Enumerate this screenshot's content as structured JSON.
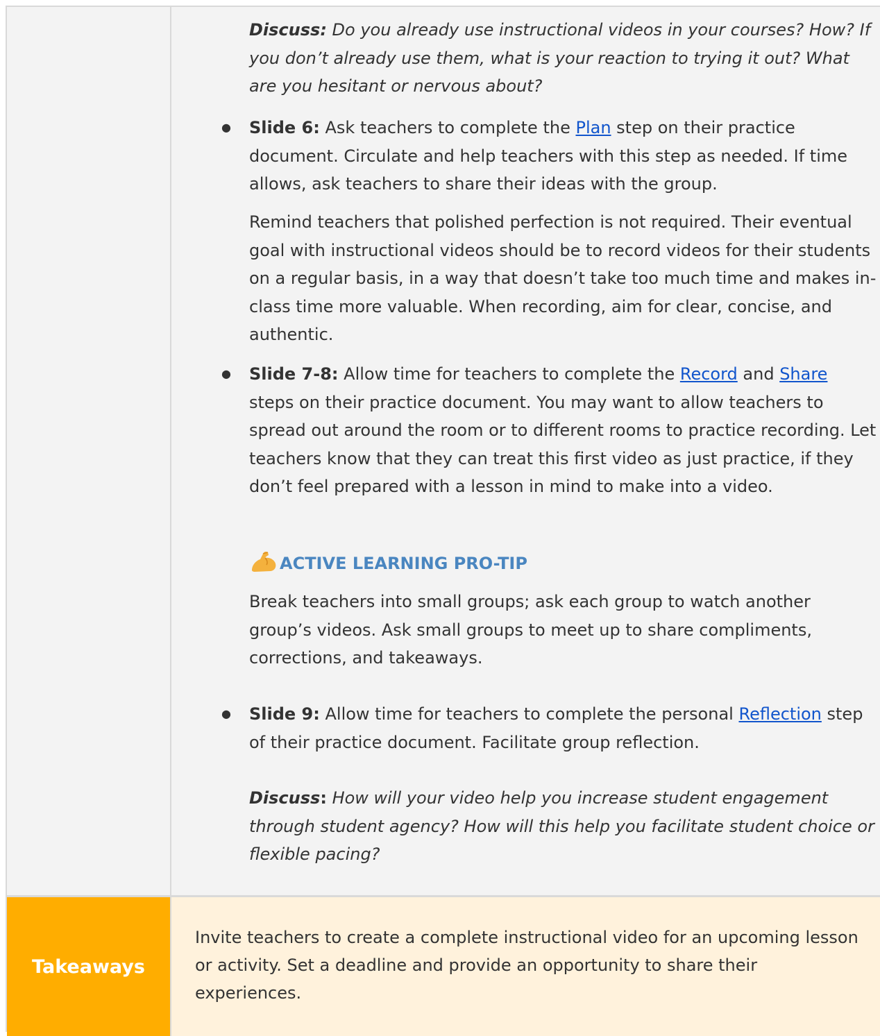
{
  "discuss1": {
    "label": "Discuss:",
    "text": " Do you already use instructional videos in your courses? How? If you don’t already use them, what is your reaction to trying it out? What are you hesitant or nervous about?"
  },
  "slide6": {
    "label": "Slide 6:",
    "text_before": " Ask teachers to complete the ",
    "link": "Plan",
    "text_after": " step on their practice document. Circulate and help teachers with this step as needed.  If time allows, ask teachers to share their ideas with the group.",
    "remind": "Remind teachers that polished perfection is not required. Their eventual goal with instructional videos should be to record videos for their students on a regular basis, in a way that doesn’t take too much time and makes in-class time more valuable. When recording, aim for clear, concise, and authentic."
  },
  "slide78": {
    "label": "Slide 7-8:",
    "text_before": " Allow time for teachers to complete the ",
    "link1": "Record",
    "text_mid": " and ",
    "link2": "Share",
    "text_after": " steps on their practice document. You may want to allow teachers to spread out around the room or to different rooms to practice recording. Let teachers know that they can treat this first video as just practice, if they don’t feel prepared with a lesson in mind to make into a video."
  },
  "protip": {
    "icon": "flexed-biceps-icon",
    "title": "ACTIVE LEARNING PRO-TIP",
    "text": "Break teachers into small groups; ask each group  to watch another group’s videos. Ask small groups to meet up to share compliments, corrections, and takeaways.",
    "color": "#4a86c0"
  },
  "slide9": {
    "label": "Slide 9:",
    "text_before": " Allow time for teachers to complete the personal ",
    "link": "Reflection",
    "text_after": " step of their practice document. Facilitate group reflection."
  },
  "discuss2": {
    "label": "Discuss",
    "colon": ":",
    "text": " How will your video help you increase student engagement through student agency? How will this help you facilitate student choice or flexible pacing?"
  },
  "takeaways": {
    "label": "Takeaways",
    "text": "Invite teachers to create a complete instructional video for an upcoming lesson or activity. Set a deadline and provide an opportunity to share their experiences.",
    "label_bg": "#ffad00",
    "cell_bg": "#fff2dc"
  },
  "colors": {
    "row_bg": "#f3f3f3",
    "border": "#d9d9d9",
    "text": "#333333",
    "link": "#1155cc"
  }
}
